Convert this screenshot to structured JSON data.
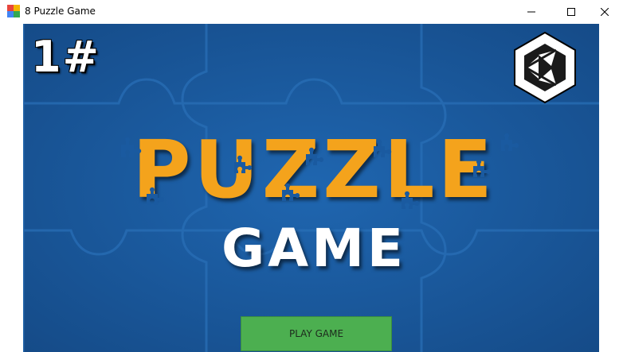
{
  "window": {
    "title": "8 Puzzle Game",
    "controls": [
      "minimize-icon",
      "maximize-icon",
      "close-icon"
    ]
  },
  "game": {
    "level_badge": "1#",
    "title_top": "PUZZLE",
    "title_bottom": "GAME",
    "play_button_label": "PLAY GAME",
    "logo": "unity-logo-icon"
  },
  "colors": {
    "background": "#1a5aa0",
    "title_orange": "#f4a31c",
    "title_white": "#ffffff",
    "play_button": "#4caf50"
  }
}
